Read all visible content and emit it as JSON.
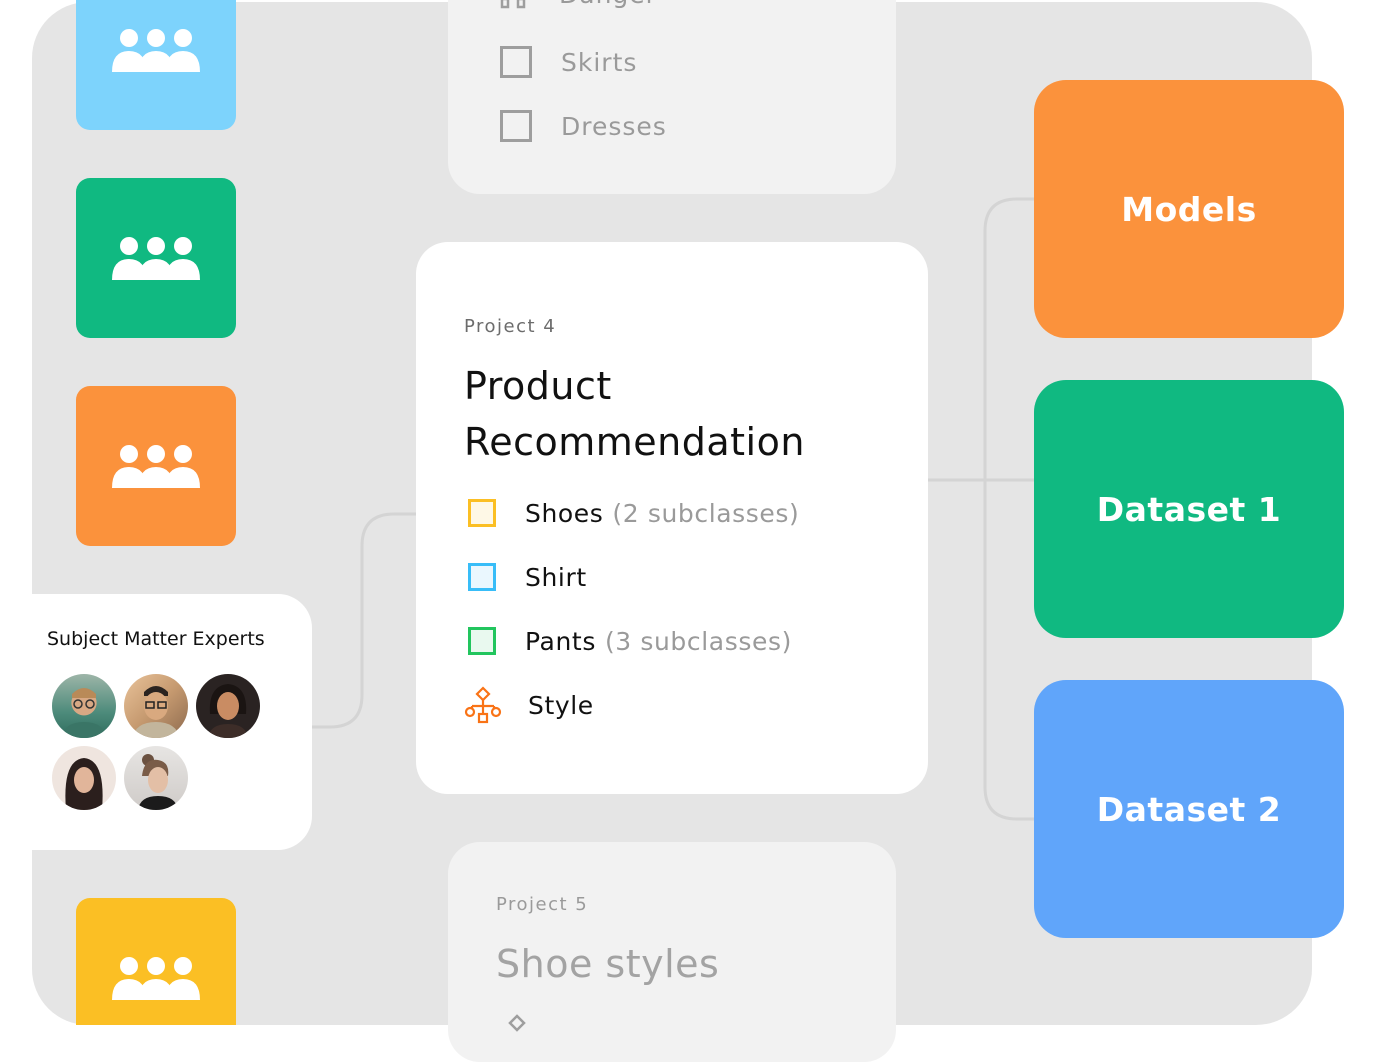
{
  "colors": {
    "canvas": "#e5e5e5",
    "team_blue": "#7dd3fc",
    "team_green": "#10b981",
    "team_orange": "#fb923c",
    "team_yellow": "#fbbf24",
    "models": "#fb923c",
    "dataset1": "#10b981",
    "dataset2": "#60a5fa",
    "shoes_box": "#fbbf24",
    "shirt_box": "#38bdf8",
    "pants_box": "#22c55e",
    "style_icon": "#f97316"
  },
  "teams": [
    {
      "icon": "team-icon",
      "color": "#7dd3fc"
    },
    {
      "icon": "team-icon",
      "color": "#10b981"
    },
    {
      "icon": "team-icon",
      "color": "#fb923c"
    },
    {
      "icon": "team-icon",
      "color": "#fbbf24"
    }
  ],
  "top_card": {
    "partial_label": "Danger",
    "items": [
      "Skirts",
      "Dresses"
    ]
  },
  "main_card": {
    "project_label": "Project 4",
    "title_line1": "Product",
    "title_line2": "Recommendation",
    "items": [
      {
        "label": "Shoes",
        "note": "(2 subclasses)",
        "icon": "checkbox-icon"
      },
      {
        "label": "Shirt",
        "note": "",
        "icon": "checkbox-icon"
      },
      {
        "label": "Pants",
        "note": "(3 subclasses)",
        "icon": "checkbox-icon"
      },
      {
        "label": "Style",
        "note": "",
        "icon": "hierarchy-icon"
      }
    ]
  },
  "bottom_card": {
    "project_label": "Project 5",
    "title": "Shoe styles"
  },
  "sme": {
    "title": "Subject Matter Experts",
    "avatars": [
      "avatar-man-glasses",
      "avatar-man-glasses-2",
      "avatar-woman-dark-hair",
      "avatar-woman-hijab",
      "avatar-woman-bun"
    ]
  },
  "blocks": {
    "models": "Models",
    "dataset1": "Dataset 1",
    "dataset2": "Dataset 2"
  }
}
